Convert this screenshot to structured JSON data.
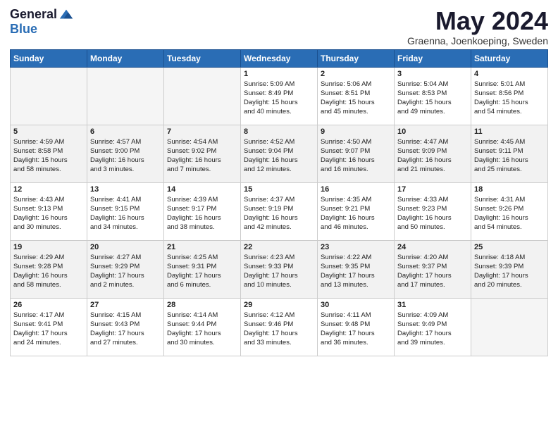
{
  "logo": {
    "line1": "General",
    "line2": "Blue"
  },
  "title": "May 2024",
  "subtitle": "Graenna, Joenkoeping, Sweden",
  "days_header": [
    "Sunday",
    "Monday",
    "Tuesday",
    "Wednesday",
    "Thursday",
    "Friday",
    "Saturday"
  ],
  "weeks": [
    [
      {
        "day": "",
        "info": ""
      },
      {
        "day": "",
        "info": ""
      },
      {
        "day": "",
        "info": ""
      },
      {
        "day": "1",
        "info": "Sunrise: 5:09 AM\nSunset: 8:49 PM\nDaylight: 15 hours\nand 40 minutes."
      },
      {
        "day": "2",
        "info": "Sunrise: 5:06 AM\nSunset: 8:51 PM\nDaylight: 15 hours\nand 45 minutes."
      },
      {
        "day": "3",
        "info": "Sunrise: 5:04 AM\nSunset: 8:53 PM\nDaylight: 15 hours\nand 49 minutes."
      },
      {
        "day": "4",
        "info": "Sunrise: 5:01 AM\nSunset: 8:56 PM\nDaylight: 15 hours\nand 54 minutes."
      }
    ],
    [
      {
        "day": "5",
        "info": "Sunrise: 4:59 AM\nSunset: 8:58 PM\nDaylight: 15 hours\nand 58 minutes."
      },
      {
        "day": "6",
        "info": "Sunrise: 4:57 AM\nSunset: 9:00 PM\nDaylight: 16 hours\nand 3 minutes."
      },
      {
        "day": "7",
        "info": "Sunrise: 4:54 AM\nSunset: 9:02 PM\nDaylight: 16 hours\nand 7 minutes."
      },
      {
        "day": "8",
        "info": "Sunrise: 4:52 AM\nSunset: 9:04 PM\nDaylight: 16 hours\nand 12 minutes."
      },
      {
        "day": "9",
        "info": "Sunrise: 4:50 AM\nSunset: 9:07 PM\nDaylight: 16 hours\nand 16 minutes."
      },
      {
        "day": "10",
        "info": "Sunrise: 4:47 AM\nSunset: 9:09 PM\nDaylight: 16 hours\nand 21 minutes."
      },
      {
        "day": "11",
        "info": "Sunrise: 4:45 AM\nSunset: 9:11 PM\nDaylight: 16 hours\nand 25 minutes."
      }
    ],
    [
      {
        "day": "12",
        "info": "Sunrise: 4:43 AM\nSunset: 9:13 PM\nDaylight: 16 hours\nand 30 minutes."
      },
      {
        "day": "13",
        "info": "Sunrise: 4:41 AM\nSunset: 9:15 PM\nDaylight: 16 hours\nand 34 minutes."
      },
      {
        "day": "14",
        "info": "Sunrise: 4:39 AM\nSunset: 9:17 PM\nDaylight: 16 hours\nand 38 minutes."
      },
      {
        "day": "15",
        "info": "Sunrise: 4:37 AM\nSunset: 9:19 PM\nDaylight: 16 hours\nand 42 minutes."
      },
      {
        "day": "16",
        "info": "Sunrise: 4:35 AM\nSunset: 9:21 PM\nDaylight: 16 hours\nand 46 minutes."
      },
      {
        "day": "17",
        "info": "Sunrise: 4:33 AM\nSunset: 9:23 PM\nDaylight: 16 hours\nand 50 minutes."
      },
      {
        "day": "18",
        "info": "Sunrise: 4:31 AM\nSunset: 9:26 PM\nDaylight: 16 hours\nand 54 minutes."
      }
    ],
    [
      {
        "day": "19",
        "info": "Sunrise: 4:29 AM\nSunset: 9:28 PM\nDaylight: 16 hours\nand 58 minutes."
      },
      {
        "day": "20",
        "info": "Sunrise: 4:27 AM\nSunset: 9:29 PM\nDaylight: 17 hours\nand 2 minutes."
      },
      {
        "day": "21",
        "info": "Sunrise: 4:25 AM\nSunset: 9:31 PM\nDaylight: 17 hours\nand 6 minutes."
      },
      {
        "day": "22",
        "info": "Sunrise: 4:23 AM\nSunset: 9:33 PM\nDaylight: 17 hours\nand 10 minutes."
      },
      {
        "day": "23",
        "info": "Sunrise: 4:22 AM\nSunset: 9:35 PM\nDaylight: 17 hours\nand 13 minutes."
      },
      {
        "day": "24",
        "info": "Sunrise: 4:20 AM\nSunset: 9:37 PM\nDaylight: 17 hours\nand 17 minutes."
      },
      {
        "day": "25",
        "info": "Sunrise: 4:18 AM\nSunset: 9:39 PM\nDaylight: 17 hours\nand 20 minutes."
      }
    ],
    [
      {
        "day": "26",
        "info": "Sunrise: 4:17 AM\nSunset: 9:41 PM\nDaylight: 17 hours\nand 24 minutes."
      },
      {
        "day": "27",
        "info": "Sunrise: 4:15 AM\nSunset: 9:43 PM\nDaylight: 17 hours\nand 27 minutes."
      },
      {
        "day": "28",
        "info": "Sunrise: 4:14 AM\nSunset: 9:44 PM\nDaylight: 17 hours\nand 30 minutes."
      },
      {
        "day": "29",
        "info": "Sunrise: 4:12 AM\nSunset: 9:46 PM\nDaylight: 17 hours\nand 33 minutes."
      },
      {
        "day": "30",
        "info": "Sunrise: 4:11 AM\nSunset: 9:48 PM\nDaylight: 17 hours\nand 36 minutes."
      },
      {
        "day": "31",
        "info": "Sunrise: 4:09 AM\nSunset: 9:49 PM\nDaylight: 17 hours\nand 39 minutes."
      },
      {
        "day": "",
        "info": ""
      }
    ]
  ]
}
